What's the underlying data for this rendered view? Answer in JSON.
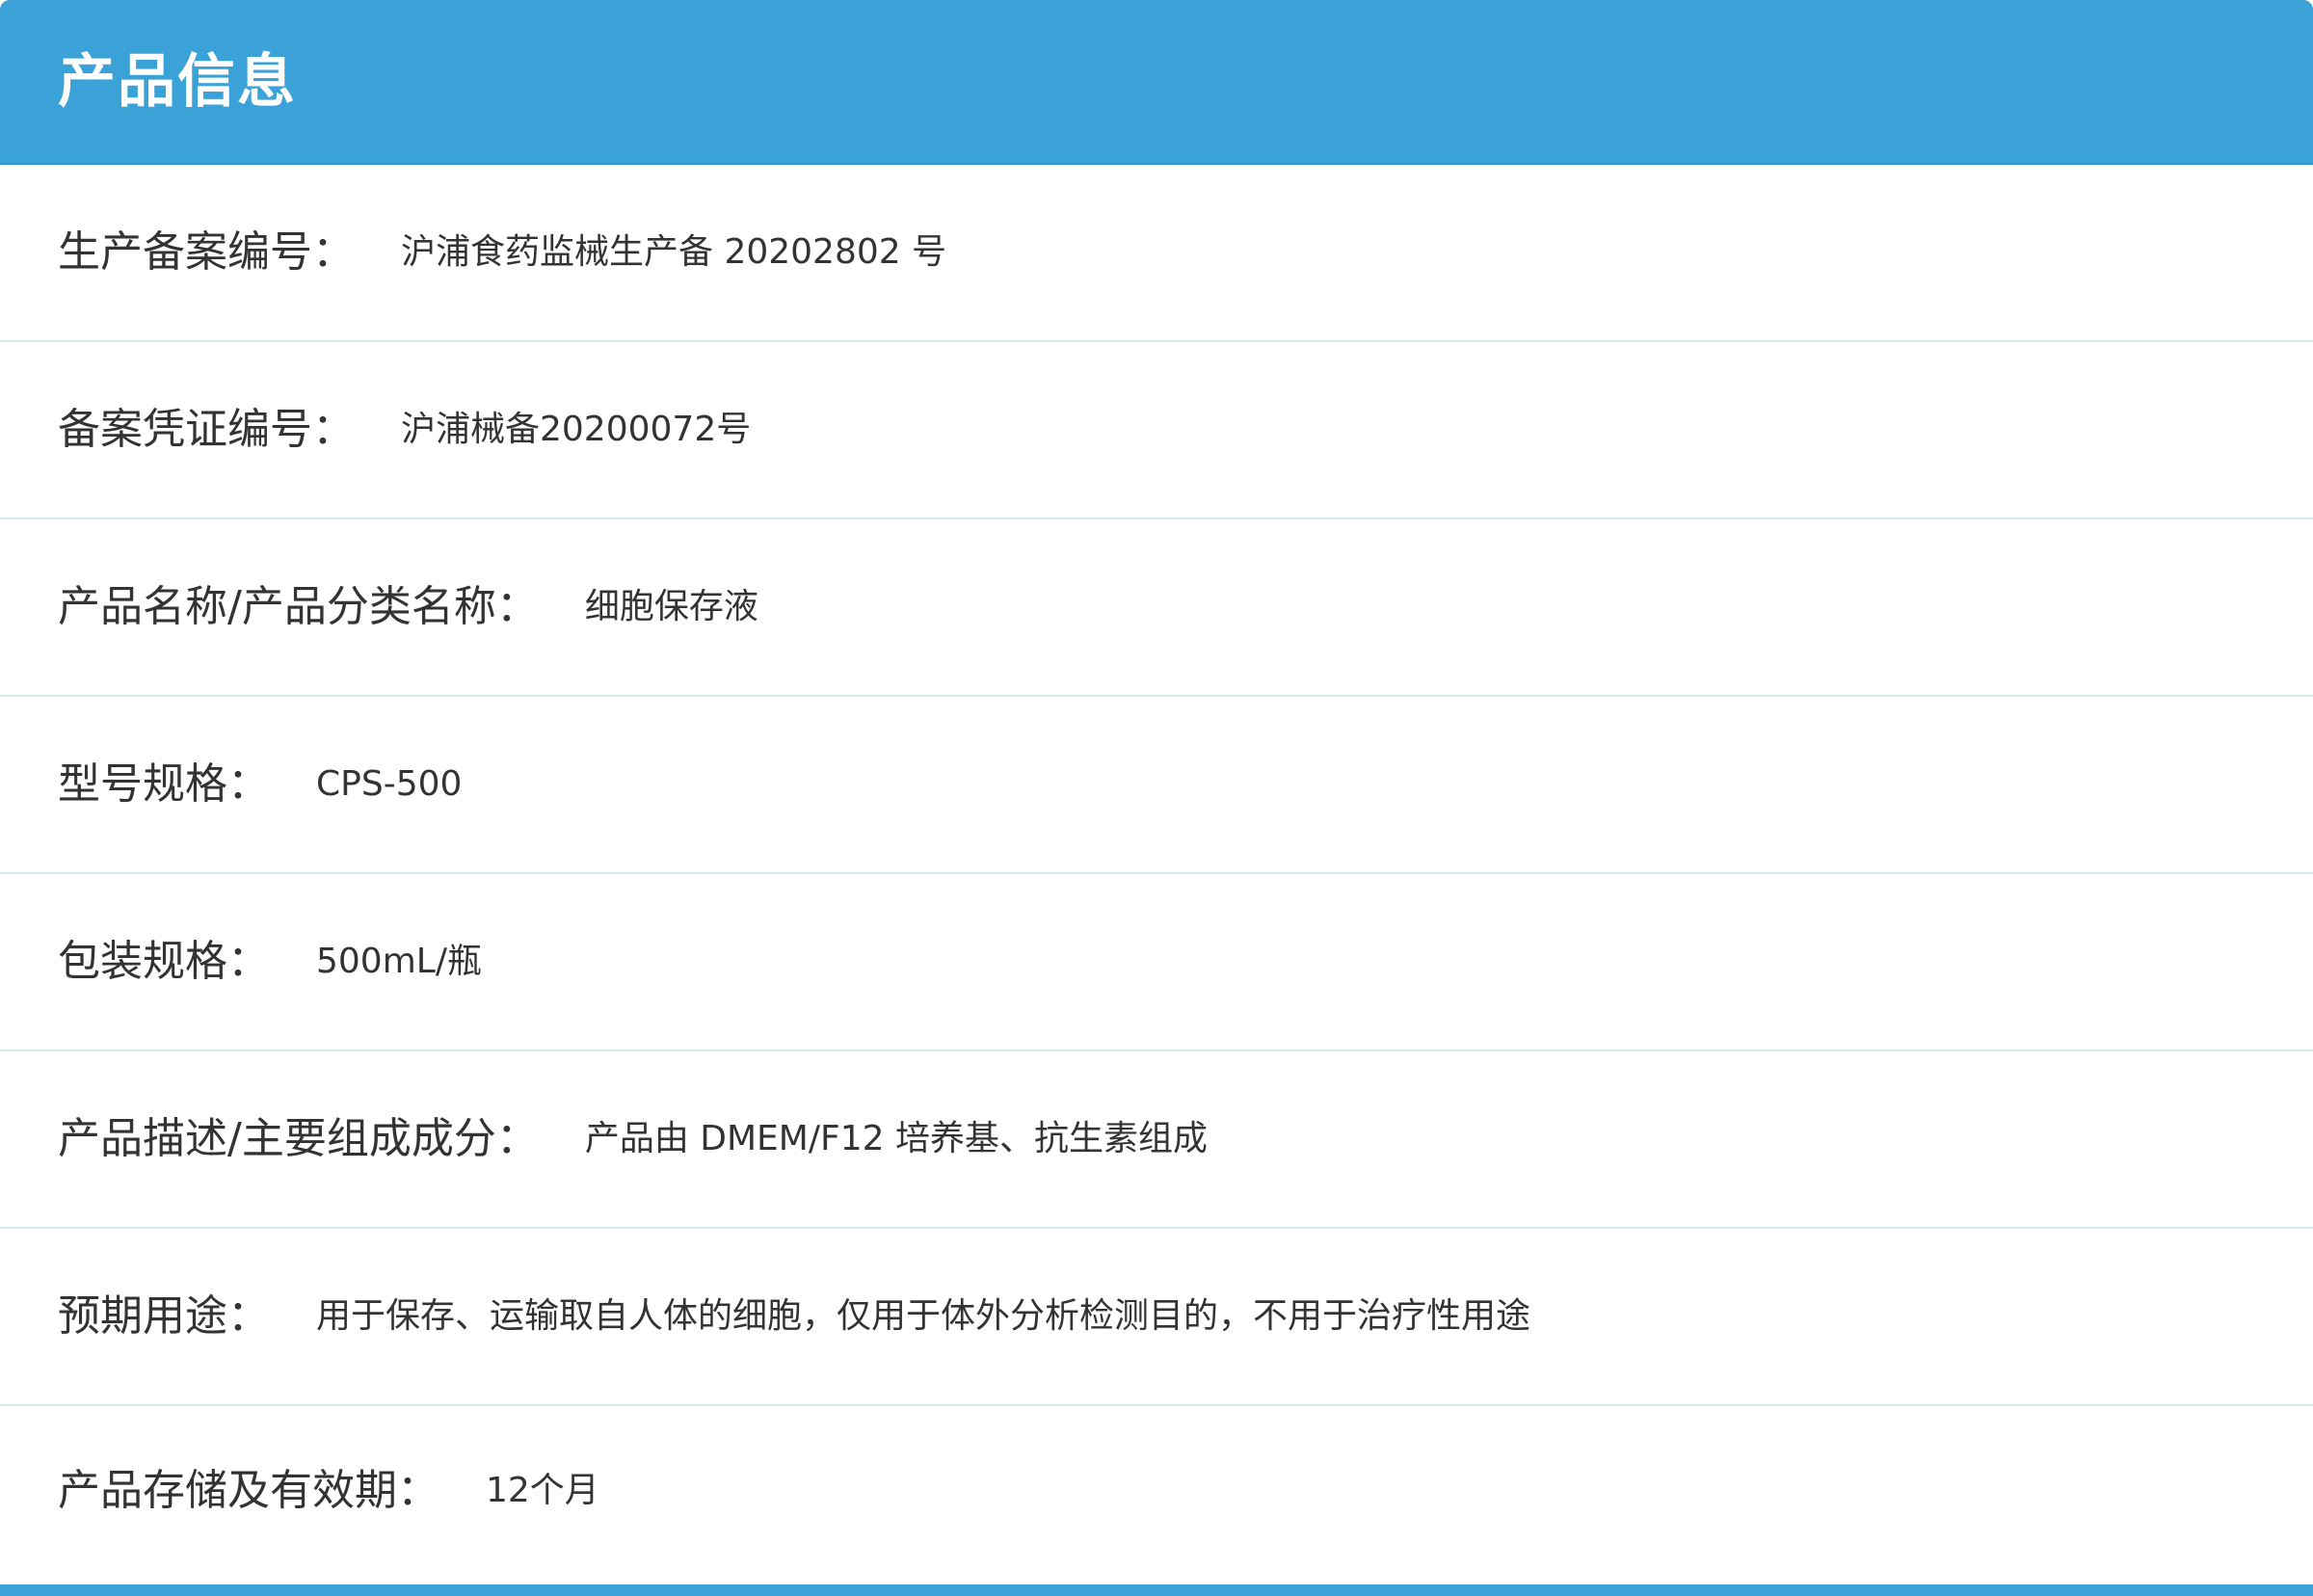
{
  "header": {
    "title": "产品信息"
  },
  "rows": [
    {
      "label": "生产备案编号：",
      "value": "沪浦食药监械生产备 20202802 号"
    },
    {
      "label": "备案凭证编号：",
      "value": "沪浦械备20200072号"
    },
    {
      "label": "产品名称/产品分类名称：",
      "value": "细胞保存液"
    },
    {
      "label": "型号规格：",
      "value": "CPS-500"
    },
    {
      "label": "包装规格：",
      "value": "500mL/瓶"
    },
    {
      "label": "产品描述/主要组成成分：",
      "value": "产品由 DMEM/F12 培养基、抗生素组成"
    },
    {
      "label": "预期用途：",
      "value": "用于保存、运输取自人体的细胞，仅用于体外分析检测目的，不用于治疗性用途"
    },
    {
      "label": "产品存储及有效期：",
      "value": "12个月"
    }
  ],
  "colors": {
    "header_background": "#3ba2d8",
    "row_divider": "#d4e8f4",
    "text": "#333333"
  }
}
